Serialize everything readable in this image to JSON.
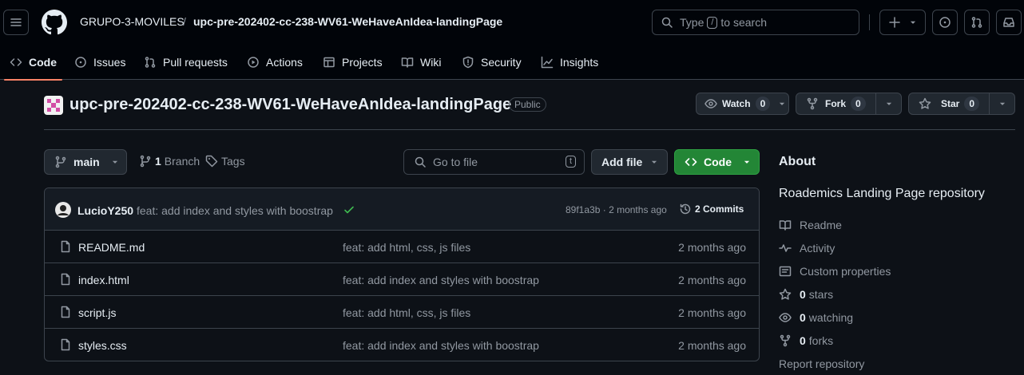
{
  "header": {
    "owner": "GRUPO-3-MOVILES",
    "separator": "/",
    "repo": "upc-pre-202402-cc-238-WV61-WeHaveAnIdea-landingPage",
    "search_prefix": "Type",
    "search_key": "/",
    "search_suffix": "to search"
  },
  "nav": {
    "tabs": [
      "Code",
      "Issues",
      "Pull requests",
      "Actions",
      "Projects",
      "Wiki",
      "Security",
      "Insights"
    ]
  },
  "repo": {
    "title": "upc-pre-202402-cc-238-WV61-WeHaveAnIdea-landingPage",
    "visibility": "Public",
    "watch_label": "Watch",
    "watch_count": "0",
    "fork_label": "Fork",
    "fork_count": "0",
    "star_label": "Star",
    "star_count": "0"
  },
  "toolbar": {
    "branch": "main",
    "branch_count": "1",
    "branch_label": "Branch",
    "tags_label": "Tags",
    "goto_placeholder": "Go to file",
    "goto_key": "t",
    "add_file": "Add file",
    "code": "Code"
  },
  "commit": {
    "author": "LucioY250",
    "message": "feat: add index and styles with boostrap",
    "hash": "89f1a3b",
    "dot": "·",
    "time": "2 months ago",
    "commits_label": "2 Commits"
  },
  "files": [
    {
      "name": "README.md",
      "message": "feat: add html, css, js files",
      "date": "2 months ago"
    },
    {
      "name": "index.html",
      "message": "feat: add index and styles with boostrap",
      "date": "2 months ago"
    },
    {
      "name": "script.js",
      "message": "feat: add html, css, js files",
      "date": "2 months ago"
    },
    {
      "name": "styles.css",
      "message": "feat: add index and styles with boostrap",
      "date": "2 months ago"
    }
  ],
  "about": {
    "heading": "About",
    "description": "Roademics Landing Page repository",
    "readme": "Readme",
    "activity": "Activity",
    "custom_properties": "Custom properties",
    "stars_count": "0",
    "stars_label": "stars",
    "watching_count": "0",
    "watching_label": "watching",
    "forks_count": "0",
    "forks_label": "forks",
    "report": "Report repository"
  },
  "colors": {
    "background": "#0d1117",
    "header": "#010409",
    "accent_tab": "#f78166",
    "code_button": "#238636",
    "success": "#3fb950"
  }
}
